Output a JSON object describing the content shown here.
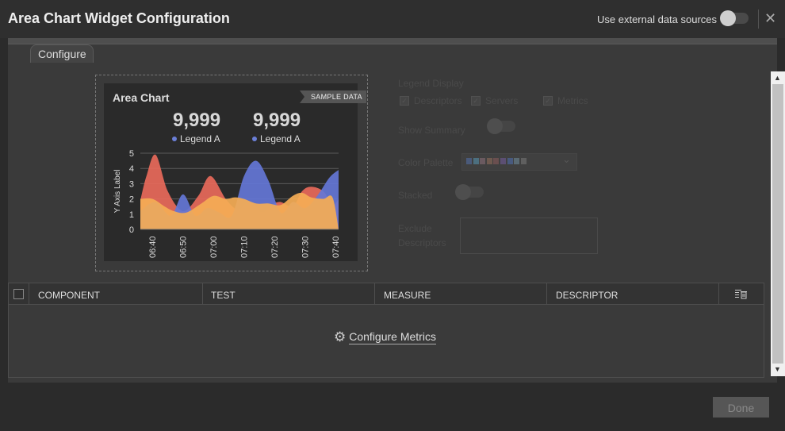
{
  "header": {
    "title": "Area Chart Widget Configuration",
    "external_label": "Use external data sources",
    "close_glyph": "✕"
  },
  "tabs": [
    {
      "label": "Configure"
    }
  ],
  "preview": {
    "title": "Area Chart",
    "sample_badge": "SAMPLE DATA",
    "stats": [
      {
        "value": "9,999",
        "legend": "Legend A"
      },
      {
        "value": "9,999",
        "legend": "Legend A"
      }
    ]
  },
  "chart_data": {
    "type": "area",
    "ylabel": "Y Axis Label",
    "ylim": [
      0,
      5
    ],
    "yticks": [
      "0",
      "1",
      "2",
      "3",
      "4",
      "5"
    ],
    "categories": [
      "06:40",
      "06:50",
      "07:00",
      "07:10",
      "07:20",
      "07:30",
      "07:40"
    ],
    "series": [
      {
        "color": "#e8695a",
        "x": [
          0,
          0.2,
          0.5,
          0.9,
          1.4,
          1.9,
          2.3,
          2.8,
          3.2,
          3.6,
          4.0,
          4.3,
          4.6,
          5.0,
          5.3,
          5.6,
          6.0,
          6.3,
          6.5
        ],
        "values": [
          1.9,
          3.5,
          4.9,
          2.5,
          1.2,
          2.2,
          3.5,
          2.0,
          1.3,
          1.8,
          1.1,
          1.6,
          1.8,
          1.5,
          2.5,
          2.8,
          2.5,
          1.6,
          2.0
        ]
      },
      {
        "color": "#6476d6",
        "x": [
          0,
          0.5,
          1.0,
          1.4,
          1.8,
          2.2,
          2.6,
          3.0,
          3.4,
          3.8,
          4.2,
          4.6,
          5.0,
          5.4,
          5.8,
          6.2,
          6.5
        ],
        "values": [
          1.2,
          1.8,
          0.9,
          2.3,
          0.9,
          1.4,
          1.1,
          0.9,
          3.5,
          4.5,
          3.2,
          1.1,
          1.8,
          1.4,
          2.2,
          3.4,
          3.9
        ]
      },
      {
        "color": "#f5ad55",
        "x": [
          0,
          0.4,
          0.8,
          1.1,
          1.5,
          2.0,
          2.4,
          2.8,
          3.1,
          3.4,
          3.8,
          4.2,
          4.6,
          5.0,
          5.3,
          5.6,
          6.0,
          6.3,
          6.5
        ],
        "values": [
          2.0,
          2.0,
          1.5,
          1.2,
          1.1,
          1.7,
          2.2,
          2.0,
          2.1,
          2.0,
          1.7,
          1.7,
          1.6,
          2.2,
          2.4,
          2.1,
          2.0,
          2.1,
          0
        ]
      }
    ]
  },
  "options": {
    "legend_display": "Legend Display",
    "checkboxes": [
      {
        "label": "Descriptors"
      },
      {
        "label": "Servers"
      },
      {
        "label": "Metrics"
      }
    ],
    "show_summary": "Show Summary",
    "color_palette": "Color Palette",
    "palette_colors": [
      "#4a5a7a",
      "#4c6f7f",
      "#6a5a60",
      "#6f5a4f",
      "#6a4f4f",
      "#5c4f73",
      "#485a7f",
      "#5a6a73",
      "#5f5f5f"
    ],
    "stacked": "Stacked",
    "exclude": "Exclude Descriptors"
  },
  "table": {
    "columns": [
      "COMPONENT",
      "TEST",
      "MEASURE",
      "DESCRIPTOR"
    ],
    "configure_metrics": "Configure Metrics"
  },
  "footer": {
    "done": "Done"
  }
}
